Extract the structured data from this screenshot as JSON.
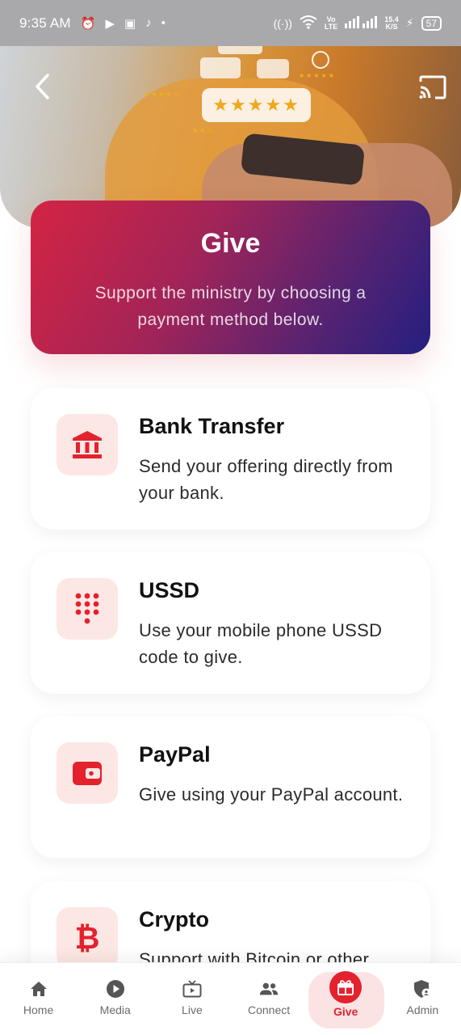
{
  "status_bar": {
    "time": "9:35 AM",
    "left_icons": [
      "alarm-icon",
      "youtube-icon",
      "app-icon",
      "tiktok-icon",
      "dot-icon"
    ],
    "network_label": "Vo\nLTE",
    "speed_value": "15.4",
    "speed_unit": "K/S",
    "battery": "57"
  },
  "hero": {
    "stars": "★★★★★"
  },
  "banner": {
    "title": "Give",
    "subtitle": "Support the ministry by choosing a payment method below."
  },
  "methods": [
    {
      "title": "Bank Transfer",
      "description": "Send your offering directly from your bank.",
      "icon": "bank-icon"
    },
    {
      "title": "USSD",
      "description": "Use your mobile phone USSD code to give.",
      "icon": "dialpad-icon"
    },
    {
      "title": "PayPal",
      "description": "Give using your PayPal account.",
      "icon": "wallet-icon"
    },
    {
      "title": "Crypto",
      "description": "Support with Bitcoin or other",
      "icon": "bitcoin-icon"
    }
  ],
  "bottom_nav": [
    {
      "label": "Home",
      "icon": "home-icon"
    },
    {
      "label": "Media",
      "icon": "play-icon"
    },
    {
      "label": "Live",
      "icon": "tv-icon"
    },
    {
      "label": "Connect",
      "icon": "people-icon"
    },
    {
      "label": "Give",
      "icon": "gift-icon",
      "active": true
    },
    {
      "label": "Admin",
      "icon": "admin-shield-icon"
    }
  ],
  "colors": {
    "accent": "#e3222e",
    "icon_bg": "#fde7e4",
    "banner_start": "#d42442",
    "banner_end": "#241f80"
  }
}
